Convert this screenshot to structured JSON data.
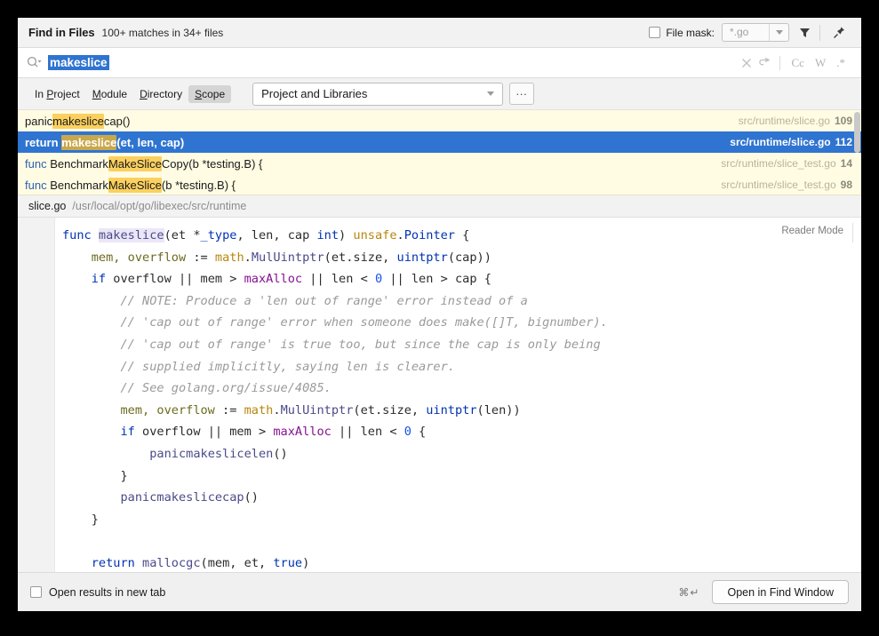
{
  "header": {
    "title": "Find in Files",
    "subtitle": "100+ matches in 34+ files",
    "file_mask_label": "File mask:",
    "file_mask_value": "*.go",
    "filter_icon": "filter-icon",
    "pin_icon": "pin-icon"
  },
  "search": {
    "value": "makeslice",
    "search_icon": "search-dropdown-icon",
    "clear_icon": "clear-icon",
    "preserve_case_icon": "preserve-case-icon",
    "toggles": [
      {
        "name": "match-case",
        "label": "Cc"
      },
      {
        "name": "words",
        "label": "W"
      },
      {
        "name": "regex",
        "label": ".*"
      }
    ]
  },
  "scope": {
    "tabs": [
      {
        "name": "in-project",
        "pre": "In ",
        "mnemonic": "P",
        "post": "roject",
        "selected": false
      },
      {
        "name": "module",
        "pre": "",
        "mnemonic": "M",
        "post": "odule",
        "selected": false
      },
      {
        "name": "directory",
        "pre": "",
        "mnemonic": "D",
        "post": "irectory",
        "selected": false
      },
      {
        "name": "scope",
        "pre": "",
        "mnemonic": "S",
        "post": "cope",
        "selected": true
      }
    ],
    "combo_value": "Project and Libraries",
    "ellipsis_label": "..."
  },
  "results": [
    {
      "prefix": "",
      "keyword": "",
      "before": "panic",
      "match": "makeslice",
      "after": "cap()",
      "path": "src/runtime/slice.go",
      "line": "109",
      "selected": false
    },
    {
      "prefix": "",
      "keyword": "return ",
      "before": "",
      "match": "makeslice",
      "after": "(et, len, cap)",
      "path": "src/runtime/slice.go",
      "line": "112",
      "selected": true
    },
    {
      "prefix": "",
      "keyword": "func ",
      "before": "Benchmark",
      "match": "MakeSlice",
      "after": "Copy(b *testing.B) {",
      "path": "src/runtime/slice_test.go",
      "line": "14",
      "selected": false
    },
    {
      "prefix": "",
      "keyword": "func ",
      "before": "Benchmark",
      "match": "MakeSlice",
      "after": "(b *testing.B) {",
      "path": "src/runtime/slice_test.go",
      "line": "98",
      "selected": false
    }
  ],
  "breadcrumb": {
    "file": "slice.go",
    "path": "/usr/local/opt/go/libexec/src/runtime"
  },
  "preview": {
    "reader_mode_label": "Reader Mode",
    "code_lines": [
      [
        {
          "t": "func ",
          "c": "kw"
        },
        {
          "t": "makeslice",
          "c": "fn fnm"
        },
        {
          "t": "(et *",
          "c": ""
        },
        {
          "t": "_type",
          "c": "typ"
        },
        {
          "t": ", len, cap ",
          "c": ""
        },
        {
          "t": "int",
          "c": "typ"
        },
        {
          "t": ") ",
          "c": ""
        },
        {
          "t": "unsafe",
          "c": "pkgo"
        },
        {
          "t": ".",
          "c": ""
        },
        {
          "t": "Pointer",
          "c": "typ"
        },
        {
          "t": " {",
          "c": ""
        }
      ],
      [
        {
          "t": "    mem, overflow",
          "c": "var"
        },
        {
          "t": " := ",
          "c": ""
        },
        {
          "t": "math",
          "c": "pkgo"
        },
        {
          "t": ".",
          "c": ""
        },
        {
          "t": "MulUintptr",
          "c": "fn"
        },
        {
          "t": "(et.size, ",
          "c": ""
        },
        {
          "t": "uintptr",
          "c": "typ"
        },
        {
          "t": "(cap))",
          "c": ""
        }
      ],
      [
        {
          "t": "    ",
          "c": ""
        },
        {
          "t": "if",
          "c": "kw"
        },
        {
          "t": " overflow || mem > ",
          "c": ""
        },
        {
          "t": "maxAlloc",
          "c": "cnst"
        },
        {
          "t": " || len < ",
          "c": ""
        },
        {
          "t": "0",
          "c": "num"
        },
        {
          "t": " || len > cap {",
          "c": ""
        }
      ],
      [
        {
          "t": "        // NOTE: Produce a 'len out of range' error instead of a",
          "c": "cm"
        }
      ],
      [
        {
          "t": "        // 'cap out of range' error when someone does make([]T, bignumber).",
          "c": "cm"
        }
      ],
      [
        {
          "t": "        // 'cap out of range' is true too, but since the cap is only being",
          "c": "cm"
        }
      ],
      [
        {
          "t": "        // supplied implicitly, saying len is clearer.",
          "c": "cm"
        }
      ],
      [
        {
          "t": "        // See golang.org/issue/4085.",
          "c": "cm"
        }
      ],
      [
        {
          "t": "        mem, overflow",
          "c": "var"
        },
        {
          "t": " := ",
          "c": ""
        },
        {
          "t": "math",
          "c": "pkgo"
        },
        {
          "t": ".",
          "c": ""
        },
        {
          "t": "MulUintptr",
          "c": "fn"
        },
        {
          "t": "(et.size, ",
          "c": ""
        },
        {
          "t": "uintptr",
          "c": "typ"
        },
        {
          "t": "(len))",
          "c": ""
        }
      ],
      [
        {
          "t": "        ",
          "c": ""
        },
        {
          "t": "if",
          "c": "kw"
        },
        {
          "t": " overflow || mem > ",
          "c": ""
        },
        {
          "t": "maxAlloc",
          "c": "cnst"
        },
        {
          "t": " || len < ",
          "c": ""
        },
        {
          "t": "0",
          "c": "num"
        },
        {
          "t": " {",
          "c": ""
        }
      ],
      [
        {
          "t": "            ",
          "c": ""
        },
        {
          "t": "panicmakeslicelen",
          "c": "fn"
        },
        {
          "t": "()",
          "c": ""
        }
      ],
      [
        {
          "t": "        }",
          "c": ""
        }
      ],
      [
        {
          "t": "        ",
          "c": ""
        },
        {
          "t": "panicmakeslicecap",
          "c": "fn"
        },
        {
          "t": "()",
          "c": ""
        }
      ],
      [
        {
          "t": "    }",
          "c": ""
        }
      ],
      [
        {
          "t": "",
          "c": ""
        }
      ],
      [
        {
          "t": "    ",
          "c": ""
        },
        {
          "t": "return",
          "c": "kw"
        },
        {
          "t": " ",
          "c": ""
        },
        {
          "t": "mallocgc",
          "c": "fn"
        },
        {
          "t": "(mem, et, ",
          "c": ""
        },
        {
          "t": "true",
          "c": "kw"
        },
        {
          "t": ")",
          "c": ""
        }
      ],
      [
        {
          "t": "}",
          "c": ""
        }
      ]
    ]
  },
  "footer": {
    "open_new_tab_label": "Open results in new tab",
    "shortcut": "⌘↵",
    "primary_button": "Open in Find Window"
  }
}
